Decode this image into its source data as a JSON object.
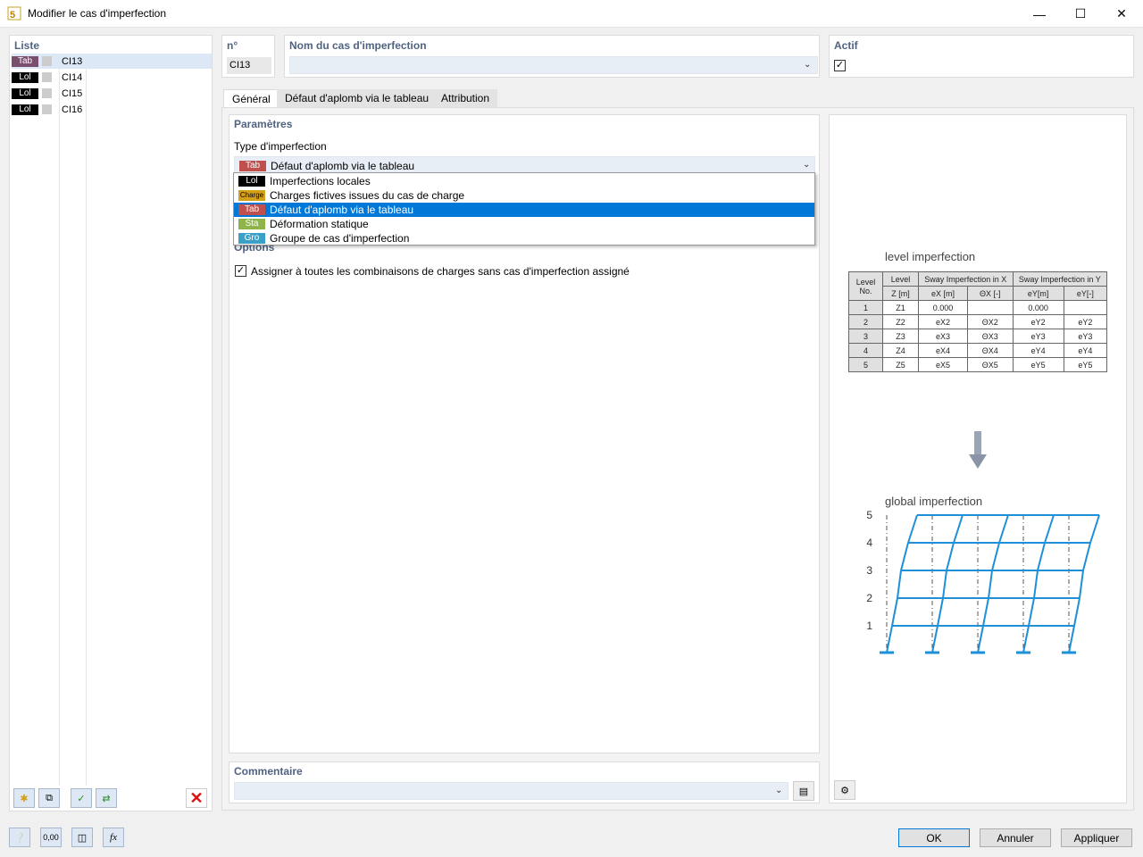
{
  "window": {
    "title": "Modifier le cas d'imperfection"
  },
  "list": {
    "title": "Liste",
    "items": [
      {
        "tag": "Tab",
        "tag_color": "#7a4f6e",
        "name": "CI13",
        "selected": true
      },
      {
        "tag": "Lol",
        "tag_color": "#000000",
        "name": "CI14"
      },
      {
        "tag": "Lol",
        "tag_color": "#000000",
        "name": "CI15"
      },
      {
        "tag": "Lol",
        "tag_color": "#000000",
        "name": "CI16"
      }
    ]
  },
  "header": {
    "no_label": "n°",
    "no_value": "CI13",
    "name_label": "Nom du cas d'imperfection",
    "name_value": "",
    "active_label": "Actif",
    "active_checked": true
  },
  "tabs": [
    {
      "label": "Général",
      "active": true
    },
    {
      "label": "Défaut d'aplomb via le tableau"
    },
    {
      "label": "Attribution"
    }
  ],
  "params": {
    "title": "Paramètres",
    "type_label": "Type d'imperfection",
    "selected": {
      "tag": "Tab",
      "tag_color": "#c0504d",
      "label": "Défaut d'aplomb via le tableau"
    },
    "options": [
      {
        "tag": "Lol",
        "tag_color": "#000000",
        "label": "Imperfections locales"
      },
      {
        "tag": "Charge",
        "tag_color": "#d4a017",
        "label": "Charges fictives issues du cas de charge"
      },
      {
        "tag": "Tab",
        "tag_color": "#c0504d",
        "label": "Défaut d'aplomb via le tableau",
        "highlighted": true
      },
      {
        "tag": "Sta",
        "tag_color": "#8fb54a",
        "label": "Déformation statique"
      },
      {
        "tag": "Gro",
        "tag_color": "#3aa0c8",
        "label": "Groupe de cas d'imperfection"
      }
    ]
  },
  "options_section": {
    "title": "Options",
    "assign_label": "Assigner à toutes les combinaisons de charges sans cas d'imperfection assigné",
    "assign_checked": true
  },
  "comment": {
    "title": "Commentaire",
    "value": ""
  },
  "preview": {
    "level_title": "level imperfection",
    "global_title": "global imperfection",
    "table": {
      "h1": [
        "Level No.",
        "Level",
        "Sway Imperfection in X",
        "Sway Imperfection in Y"
      ],
      "h2": [
        "Z [m]",
        "eX [m]",
        "ΘX [-]",
        "eY[m]",
        "eY[-]"
      ],
      "rows": [
        [
          "1",
          "Z1",
          "0.000",
          "",
          "0.000",
          ""
        ],
        [
          "2",
          "Z2",
          "eX2",
          "ΘX2",
          "eY2",
          "eY2"
        ],
        [
          "3",
          "Z3",
          "eX3",
          "ΘX3",
          "eY3",
          "eY3"
        ],
        [
          "4",
          "Z4",
          "eX4",
          "ΘX4",
          "eY4",
          "eY4"
        ],
        [
          "5",
          "Z5",
          "eX5",
          "ΘX5",
          "eY5",
          "eY5"
        ]
      ]
    },
    "frame_levels": [
      "5",
      "4",
      "3",
      "2",
      "1"
    ],
    "frame_color": "#1e90d8"
  },
  "buttons": {
    "ok": "OK",
    "cancel": "Annuler",
    "apply": "Appliquer"
  },
  "toolbar": {
    "units_label": "0,00"
  }
}
